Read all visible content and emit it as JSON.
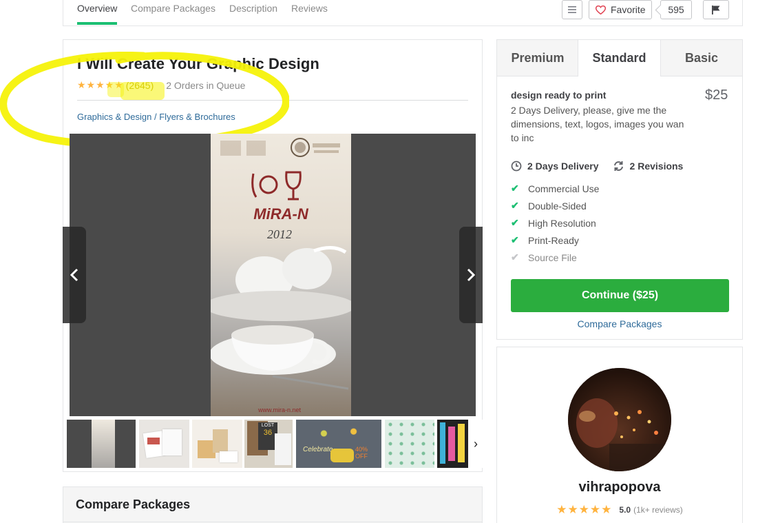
{
  "nav": {
    "tabs": [
      {
        "label": "Overview",
        "active": true
      },
      {
        "label": "Compare Packages",
        "active": false
      },
      {
        "label": "Description",
        "active": false
      },
      {
        "label": "Reviews",
        "active": false
      }
    ],
    "favorite_label": "Favorite",
    "favorite_count": "595"
  },
  "gig": {
    "title": "I Will Create Your Graphic Design",
    "stars": "★★★★★",
    "rating_count": "(2645)",
    "orders_in_queue": "2 Orders in Queue",
    "category": "Graphics & Design",
    "category_sep": " / ",
    "subcategory": "Flyers & Brochures",
    "poster": {
      "brand": "MiRA-N",
      "year": "2012",
      "url": "www.mira-n.net"
    },
    "thumb_texts": {
      "lost": "LOST",
      "lost_num": "36",
      "celebrate": "Celebrate",
      "off": "40% OFF"
    }
  },
  "compare": {
    "title": "Compare Packages"
  },
  "package": {
    "tabs": [
      "Premium",
      "Standard",
      "Basic"
    ],
    "active_tab": "Standard",
    "name": "design ready to print",
    "price": "$25",
    "description": "2 Days Delivery, please, give me the dimensions, text, logos, images you wan to inc",
    "delivery": "2 Days Delivery",
    "revisions": "2 Revisions",
    "features": [
      {
        "label": "Commercial Use",
        "included": true
      },
      {
        "label": "Double-Sided",
        "included": true
      },
      {
        "label": "High Resolution",
        "included": true
      },
      {
        "label": "Print-Ready",
        "included": true
      },
      {
        "label": "Source File",
        "included": false
      }
    ],
    "continue_label": "Continue ($25)",
    "compare_link": "Compare Packages"
  },
  "seller": {
    "name": "vihrapopova",
    "stars": "★★★★★",
    "score": "5.0",
    "reviews": "(1k+ reviews)"
  },
  "colors": {
    "accent_green": "#1dbf73",
    "button_green": "#2bad3e",
    "star": "#ffb33e",
    "highlight_yellow": "#f5f20a",
    "link_blue": "#2f6b9a"
  }
}
